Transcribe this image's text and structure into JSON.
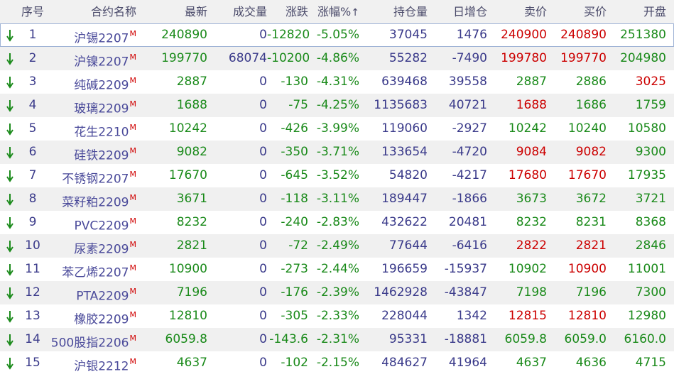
{
  "colors": {
    "up": "#cc0000",
    "down": "#1a8a1a",
    "neutral": "#3a3a8a",
    "name": "#4a4a9a"
  },
  "headers": [
    "序号",
    "合约名称",
    "最新",
    "成交量",
    "涨跌",
    "涨幅%",
    "持仓量",
    "日增仓",
    "卖价",
    "买价",
    "开盘"
  ],
  "sort_indicator": "↑",
  "contract_marker": "M",
  "rows": [
    {
      "seq": "1",
      "name": "沪锡2207",
      "last": "240890",
      "vol": "0",
      "chg": "-12820",
      "pct": "-5.05%",
      "oi": "37045",
      "oi_chg": "1476",
      "ask": "240900",
      "bid": "240890",
      "open": "251380",
      "last_c": "down",
      "ask_c": "up",
      "bid_c": "up",
      "open_c": "down",
      "oi_chg_c": "neutral"
    },
    {
      "seq": "2",
      "name": "沪镍2207",
      "last": "199770",
      "vol": "68074",
      "chg": "-10200",
      "pct": "-4.86%",
      "oi": "55282",
      "oi_chg": "-7490",
      "ask": "199780",
      "bid": "199770",
      "open": "204980",
      "last_c": "down",
      "ask_c": "up",
      "bid_c": "up",
      "open_c": "down",
      "oi_chg_c": "neutral"
    },
    {
      "seq": "3",
      "name": "纯碱2209",
      "last": "2887",
      "vol": "0",
      "chg": "-130",
      "pct": "-4.31%",
      "oi": "639468",
      "oi_chg": "39558",
      "ask": "2887",
      "bid": "2886",
      "open": "3025",
      "last_c": "down",
      "ask_c": "down",
      "bid_c": "down",
      "open_c": "up",
      "oi_chg_c": "neutral"
    },
    {
      "seq": "4",
      "name": "玻璃2209",
      "last": "1688",
      "vol": "0",
      "chg": "-75",
      "pct": "-4.25%",
      "oi": "1135683",
      "oi_chg": "40721",
      "ask": "1688",
      "bid": "1686",
      "open": "1759",
      "last_c": "down",
      "ask_c": "up",
      "bid_c": "down",
      "open_c": "down",
      "oi_chg_c": "neutral"
    },
    {
      "seq": "5",
      "name": "花生2210",
      "last": "10242",
      "vol": "0",
      "chg": "-426",
      "pct": "-3.99%",
      "oi": "119060",
      "oi_chg": "-2927",
      "ask": "10242",
      "bid": "10240",
      "open": "10580",
      "last_c": "down",
      "ask_c": "down",
      "bid_c": "down",
      "open_c": "down",
      "oi_chg_c": "neutral"
    },
    {
      "seq": "6",
      "name": "硅铁2209",
      "last": "9082",
      "vol": "0",
      "chg": "-350",
      "pct": "-3.71%",
      "oi": "133654",
      "oi_chg": "-4720",
      "ask": "9084",
      "bid": "9082",
      "open": "9300",
      "last_c": "down",
      "ask_c": "up",
      "bid_c": "up",
      "open_c": "down",
      "oi_chg_c": "neutral"
    },
    {
      "seq": "7",
      "name": "不锈钢2207",
      "last": "17670",
      "vol": "0",
      "chg": "-645",
      "pct": "-3.52%",
      "oi": "54820",
      "oi_chg": "-4217",
      "ask": "17680",
      "bid": "17670",
      "open": "17935",
      "last_c": "down",
      "ask_c": "up",
      "bid_c": "up",
      "open_c": "down",
      "oi_chg_c": "neutral"
    },
    {
      "seq": "8",
      "name": "菜籽粕2209",
      "last": "3671",
      "vol": "0",
      "chg": "-118",
      "pct": "-3.11%",
      "oi": "189447",
      "oi_chg": "-1866",
      "ask": "3673",
      "bid": "3672",
      "open": "3721",
      "last_c": "down",
      "ask_c": "down",
      "bid_c": "down",
      "open_c": "down",
      "oi_chg_c": "neutral"
    },
    {
      "seq": "9",
      "name": "PVC2209",
      "last": "8232",
      "vol": "0",
      "chg": "-240",
      "pct": "-2.83%",
      "oi": "432622",
      "oi_chg": "20481",
      "ask": "8232",
      "bid": "8231",
      "open": "8368",
      "last_c": "down",
      "ask_c": "down",
      "bid_c": "down",
      "open_c": "down",
      "oi_chg_c": "neutral"
    },
    {
      "seq": "10",
      "name": "尿素2209",
      "last": "2821",
      "vol": "0",
      "chg": "-72",
      "pct": "-2.49%",
      "oi": "77644",
      "oi_chg": "-6416",
      "ask": "2822",
      "bid": "2821",
      "open": "2846",
      "last_c": "down",
      "ask_c": "up",
      "bid_c": "up",
      "open_c": "down",
      "oi_chg_c": "neutral"
    },
    {
      "seq": "11",
      "name": "苯乙烯2207",
      "last": "10900",
      "vol": "0",
      "chg": "-273",
      "pct": "-2.44%",
      "oi": "196659",
      "oi_chg": "-15937",
      "ask": "10902",
      "bid": "10900",
      "open": "11001",
      "last_c": "down",
      "ask_c": "down",
      "bid_c": "up",
      "open_c": "down",
      "oi_chg_c": "neutral"
    },
    {
      "seq": "12",
      "name": "PTA2209",
      "last": "7196",
      "vol": "0",
      "chg": "-176",
      "pct": "-2.39%",
      "oi": "1462928",
      "oi_chg": "-43847",
      "ask": "7198",
      "bid": "7196",
      "open": "7300",
      "last_c": "down",
      "ask_c": "down",
      "bid_c": "down",
      "open_c": "down",
      "oi_chg_c": "neutral"
    },
    {
      "seq": "13",
      "name": "橡胶2209",
      "last": "12810",
      "vol": "0",
      "chg": "-305",
      "pct": "-2.33%",
      "oi": "228044",
      "oi_chg": "1342",
      "ask": "12815",
      "bid": "12810",
      "open": "12980",
      "last_c": "down",
      "ask_c": "up",
      "bid_c": "up",
      "open_c": "down",
      "oi_chg_c": "neutral"
    },
    {
      "seq": "14",
      "name": "500股指2206",
      "last": "6059.8",
      "vol": "0",
      "chg": "-143.6",
      "pct": "-2.31%",
      "oi": "95331",
      "oi_chg": "-18881",
      "ask": "6059.8",
      "bid": "6059.0",
      "open": "6160.0",
      "last_c": "down",
      "ask_c": "down",
      "bid_c": "down",
      "open_c": "down",
      "oi_chg_c": "neutral"
    },
    {
      "seq": "15",
      "name": "沪银2212",
      "last": "4637",
      "vol": "0",
      "chg": "-102",
      "pct": "-2.15%",
      "oi": "484627",
      "oi_chg": "41964",
      "ask": "4637",
      "bid": "4636",
      "open": "4715",
      "last_c": "down",
      "ask_c": "down",
      "bid_c": "down",
      "open_c": "down",
      "oi_chg_c": "neutral"
    }
  ]
}
